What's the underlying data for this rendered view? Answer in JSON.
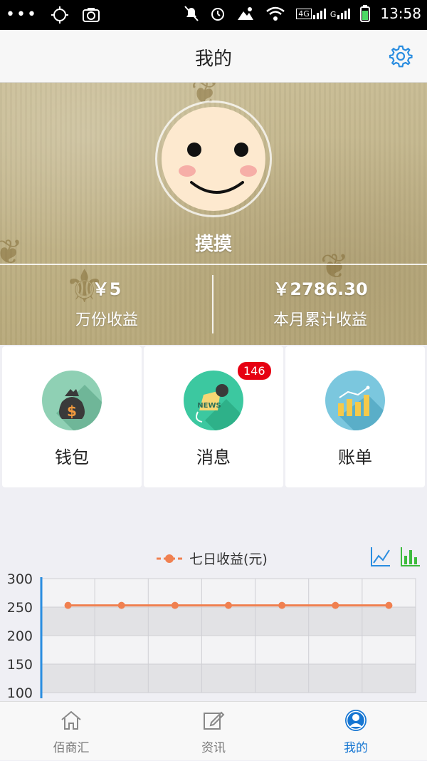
{
  "status_bar": {
    "time": "13:58",
    "network_4g": "4G",
    "network_g": "G",
    "icons": [
      "more-dots-icon",
      "location-target-icon",
      "camera-icon",
      "mute-icon",
      "alarm-icon",
      "weather-icon",
      "wifi-icon",
      "signal-icon",
      "battery-icon"
    ]
  },
  "header": {
    "title": "我的",
    "settings_icon": "gear-icon"
  },
  "profile": {
    "name": "摸摸",
    "stats": [
      {
        "value": "￥5",
        "label": "万份收益"
      },
      {
        "value": "￥2786.30",
        "label": "本月累计收益"
      }
    ]
  },
  "tiles": [
    {
      "label": "钱包",
      "icon": "money-bag-icon",
      "color": "#8fd0b4"
    },
    {
      "label": "消息",
      "icon": "news-microphone-icon",
      "color": "#3cc8a0",
      "badge": "146"
    },
    {
      "label": "账单",
      "icon": "bar-chart-icon",
      "color": "#7bc7de"
    }
  ],
  "chart_data": {
    "type": "line",
    "title": "",
    "series": [
      {
        "name": "七日收益(元)",
        "values": [
          253,
          253,
          253,
          253,
          253,
          253,
          253
        ]
      }
    ],
    "x": [
      1,
      2,
      3,
      4,
      5,
      6,
      7
    ],
    "yticks": [
      "300",
      "250",
      "200",
      "150",
      "100"
    ],
    "ylim": [
      100,
      300
    ],
    "grid": true,
    "legend_position": "top-center",
    "line_color": "#f08050"
  },
  "chart_toggle": {
    "icons": [
      "line-chart-icon",
      "bar-chart-icon"
    ]
  },
  "tabbar": [
    {
      "label": "佰商汇",
      "icon": "home-icon",
      "active": false
    },
    {
      "label": "资讯",
      "icon": "edit-icon",
      "active": false
    },
    {
      "label": "我的",
      "icon": "user-icon",
      "active": true
    }
  ]
}
